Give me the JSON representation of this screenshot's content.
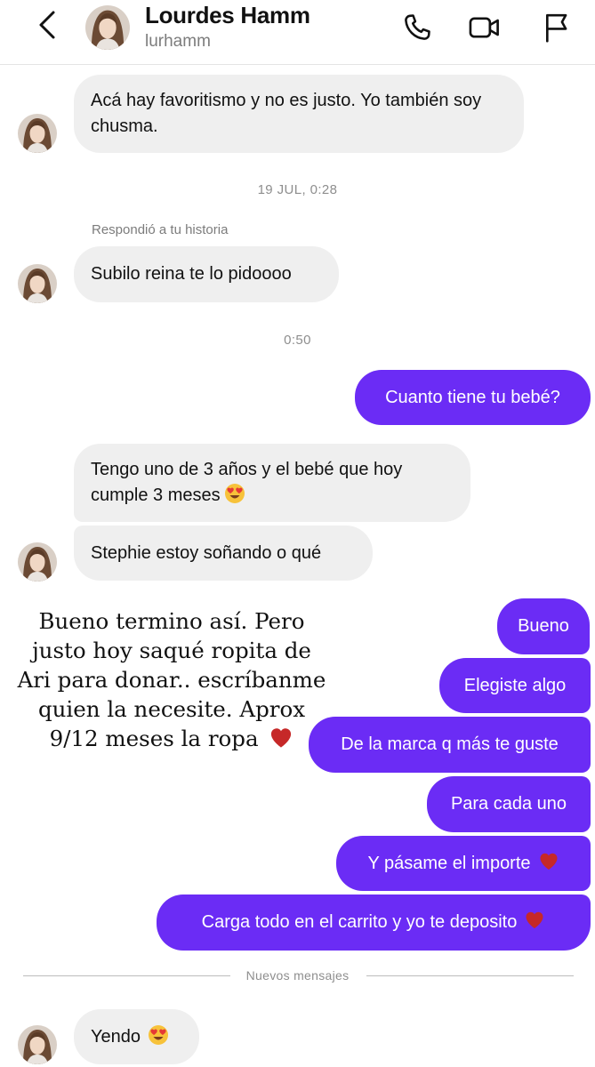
{
  "header": {
    "name": "Lourdes Hamm",
    "username": "lurhamm",
    "icons": [
      "back-arrow-icon",
      "phone-icon",
      "video-camera-icon",
      "flag-icon"
    ]
  },
  "conversation": {
    "msg1": "Acá hay favoritismo y no es justo. Yo también soy chusma.",
    "timestamp1": "19 JUL, 0:28",
    "story_reply_label": "Respondió a tu historia",
    "msg2": "Subilo reina te lo pidoooo",
    "timestamp2": "0:50",
    "msg3": "Cuanto tiene tu bebé?",
    "msg4": "Tengo uno de 3 años y el bebé que hoy cumple 3 meses",
    "msg5": "Stephie estoy soñando o qué",
    "out1": "Bueno",
    "out2": "Elegiste algo",
    "out3": "De la marca q más te guste",
    "out4": "Para cada uno",
    "out5": "Y pásame el importe",
    "out6": "Carga todo en el carrito y yo te deposito",
    "new_messages_label": "Nuevos mensajes",
    "msg6": "Yendo"
  },
  "story_overlay": {
    "text": "Bueno termino así. Pero justo hoy saqué ropita de Ari para donar.. escríbanme quien la necesite. Aprox 9/12 meses la ropa"
  },
  "colors": {
    "outgoing_bubble": "#6b2cf5",
    "incoming_bubble": "#efefef",
    "heart": "#c62828"
  }
}
